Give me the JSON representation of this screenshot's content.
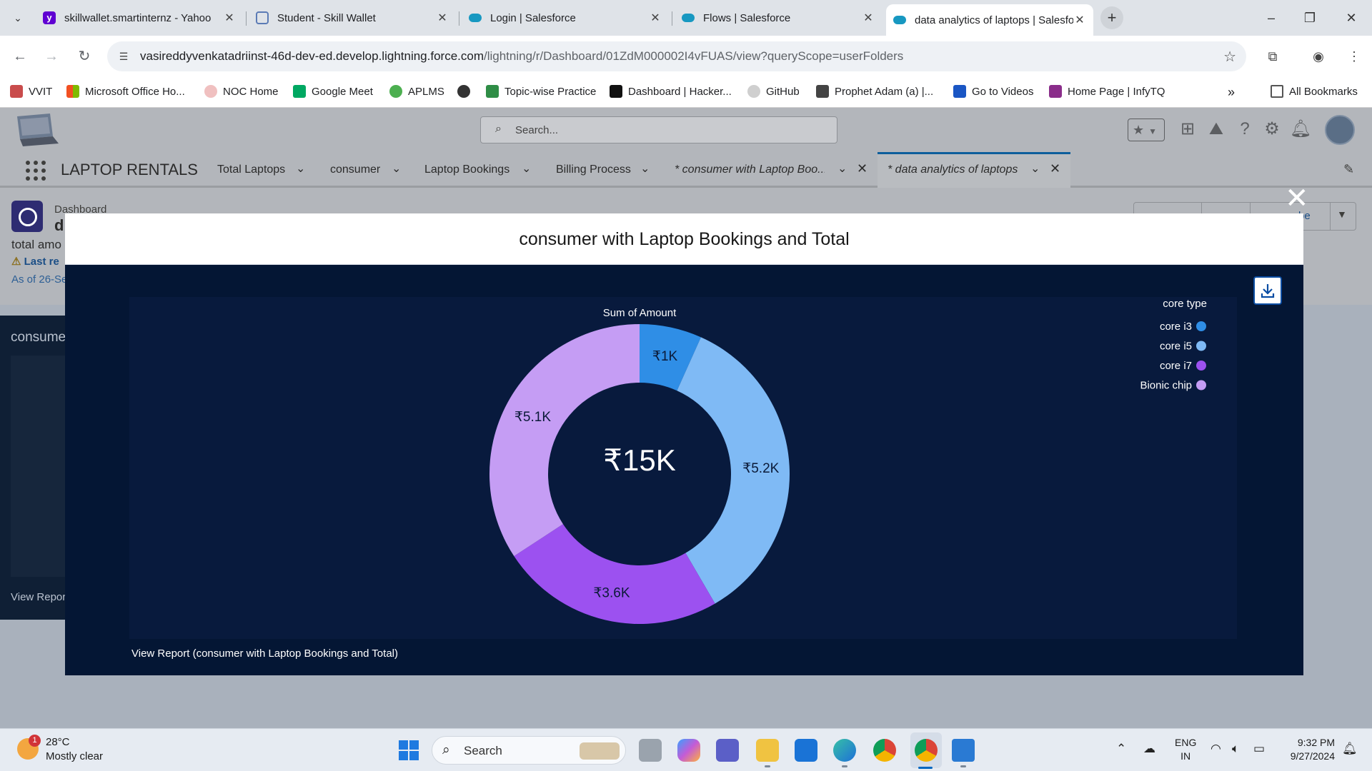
{
  "browser": {
    "tabs": [
      {
        "title": "skillwallet.smartinternz - Yahoo",
        "favicon": "yahoo-icon",
        "color": "#6001d2"
      },
      {
        "title": "Student - Skill Wallet",
        "favicon": "skillwallet-icon",
        "color": "#5b7bb5"
      },
      {
        "title": "Login | Salesforce",
        "favicon": "salesforce-cloud-icon",
        "color": "#1798c1"
      },
      {
        "title": "Flows | Salesforce",
        "favicon": "salesforce-cloud-icon",
        "color": "#1798c1"
      },
      {
        "title": "data analytics of laptops | Salesforce",
        "favicon": "salesforce-cloud-icon",
        "color": "#1798c1"
      }
    ],
    "url_main": "vasireddyvenkatadriinst-46d-dev-ed.develop.lightning.force.com",
    "url_path": "/lightning/r/Dashboard/01ZdM000002I4vFUAS/view?queryScope=userFolders",
    "bookmarks": [
      "VVIT",
      "Microsoft Office Ho...",
      "NOC Home",
      "Google Meet",
      "APLMS",
      "",
      "Topic-wise Practice",
      "Dashboard | Hacker...",
      "GitHub",
      "Prophet Adam (a) |...",
      "Go to Videos",
      "Home Page | InfyTQ"
    ],
    "all_bookmarks": "All Bookmarks"
  },
  "sf": {
    "search_placeholder": "Search...",
    "app_name": "LAPTOP RENTALS",
    "nav": [
      "Total Laptops",
      "consumer",
      "Laptop Bookings",
      "Billing Process"
    ],
    "open_tabs": [
      "* consumer with Laptop Boo...",
      "* data analytics of laptops"
    ],
    "dashboard_label": "Dashboard",
    "dashboard_title_fragment": "d",
    "dashboard_desc_fragment": "total amo",
    "warn_fragment": "Last re",
    "asof_fragment": "As of 26-Se",
    "subscribe_fragment": "be",
    "left_card_title": "consume",
    "left_card_link": "View Repor"
  },
  "modal": {
    "title": "consumer with Laptop Bookings and Total",
    "view_report": "View Report (consumer with Laptop Bookings and Total)"
  },
  "chart_data": {
    "type": "donut",
    "title": "Sum of Amount",
    "center_total": "₹15K",
    "legend_title": "core type",
    "legend_position": "top-right",
    "slices": [
      {
        "name": "core i3",
        "value": 1000,
        "label": "₹1K",
        "color": "#2f8ee6"
      },
      {
        "name": "core i5",
        "value": 5200,
        "label": "₹5.2K",
        "color": "#7fbaf5"
      },
      {
        "name": "core i7",
        "value": 3600,
        "label": "₹3.6K",
        "color": "#9c51f0"
      },
      {
        "name": "Bionic chip",
        "value": 5100,
        "label": "₹5.1K",
        "color": "#c59df4"
      }
    ]
  },
  "taskbar": {
    "temp": "28°C",
    "weather": "Mostly clear",
    "weather_badge": "1",
    "search": "Search",
    "lang1": "ENG",
    "lang2": "IN",
    "time": "9:32 PM",
    "date": "9/27/2024"
  }
}
